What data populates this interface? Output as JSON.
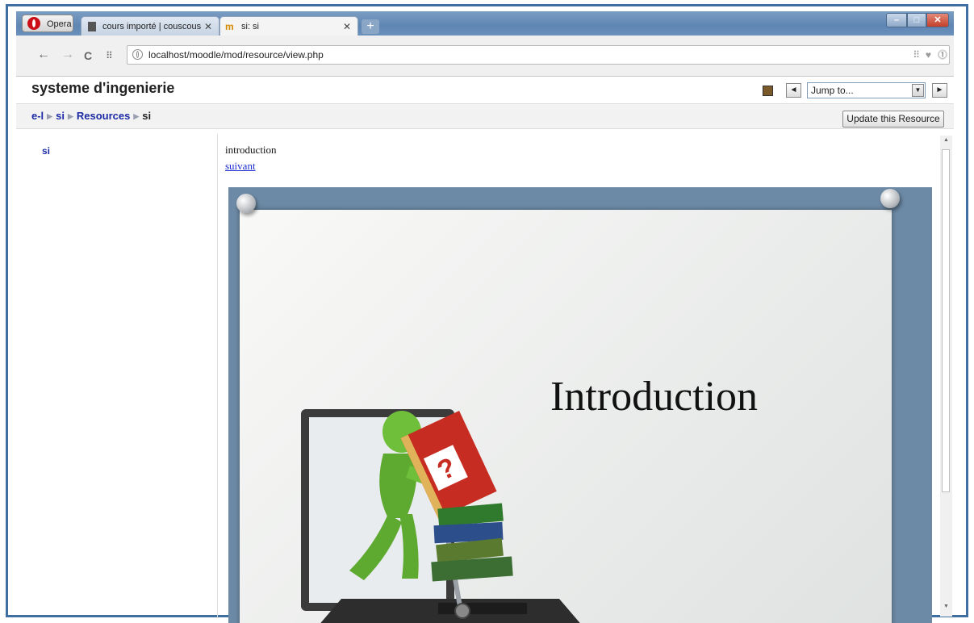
{
  "browser": {
    "opera_label": "Opera",
    "tabs": [
      {
        "label": "cours importé | couscous",
        "active": false
      },
      {
        "label": "si: si",
        "active": true
      }
    ],
    "url": "localhost/moodle/mod/resource/view.php"
  },
  "header": {
    "site_title": "systeme d'ingenierie",
    "jump_select": "Jump to..."
  },
  "breadcrumb": {
    "items": [
      "e-l",
      "si",
      "Resources"
    ],
    "current": "si"
  },
  "update_button": "Update this Resource",
  "sidebar": {
    "link": "si"
  },
  "content": {
    "text": "introduction",
    "link": "suivant",
    "slide_title": "Introduction"
  },
  "colors": {
    "link": "#1c2aa5",
    "frame": "#3f6ea0",
    "tabbar": "#5f86b3"
  }
}
